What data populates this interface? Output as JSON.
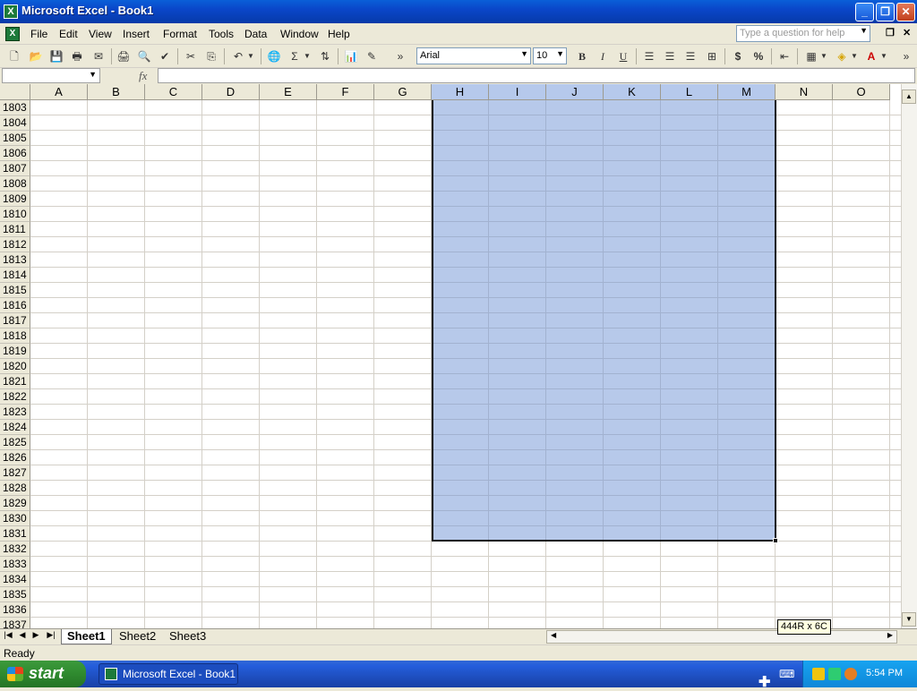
{
  "window": {
    "title": "Microsoft Excel - Book1"
  },
  "menu": {
    "items": [
      "File",
      "Edit",
      "View",
      "Insert",
      "Format",
      "Tools",
      "Data",
      "Window",
      "Help"
    ],
    "help_placeholder": "Type a question for help"
  },
  "toolbar": {
    "font_name": "Arial",
    "font_size": "10"
  },
  "formula": {
    "name_box": "",
    "fx_label": "fx",
    "content": ""
  },
  "columns": [
    "A",
    "B",
    "C",
    "D",
    "E",
    "F",
    "G",
    "H",
    "I",
    "J",
    "K",
    "L",
    "M",
    "N",
    "O"
  ],
  "selected_columns": [
    "H",
    "I",
    "J",
    "K",
    "L",
    "M"
  ],
  "rows": [
    "1803",
    "1804",
    "1805",
    "1806",
    "1807",
    "1808",
    "1809",
    "1810",
    "1811",
    "1812",
    "1813",
    "1814",
    "1815",
    "1816",
    "1817",
    "1818",
    "1819",
    "1820",
    "1821",
    "1822",
    "1823",
    "1824",
    "1825",
    "1826",
    "1827",
    "1828",
    "1829",
    "1830",
    "1831",
    "1832",
    "1833",
    "1834",
    "1835",
    "1836",
    "1837"
  ],
  "sheets": [
    "Sheet1",
    "Sheet2",
    "Sheet3"
  ],
  "active_sheet": "Sheet1",
  "selection_tooltip": "444R x 6C",
  "status": "Ready",
  "taskbar": {
    "start_label": "start",
    "task_label": "Microsoft Excel - Book1",
    "clock": "5:54 PM"
  },
  "colors": {
    "selection": "#b6c9ec",
    "title_bar": "#0a46c9",
    "taskbar": "#245ddb",
    "start": "#2f8a2f"
  }
}
